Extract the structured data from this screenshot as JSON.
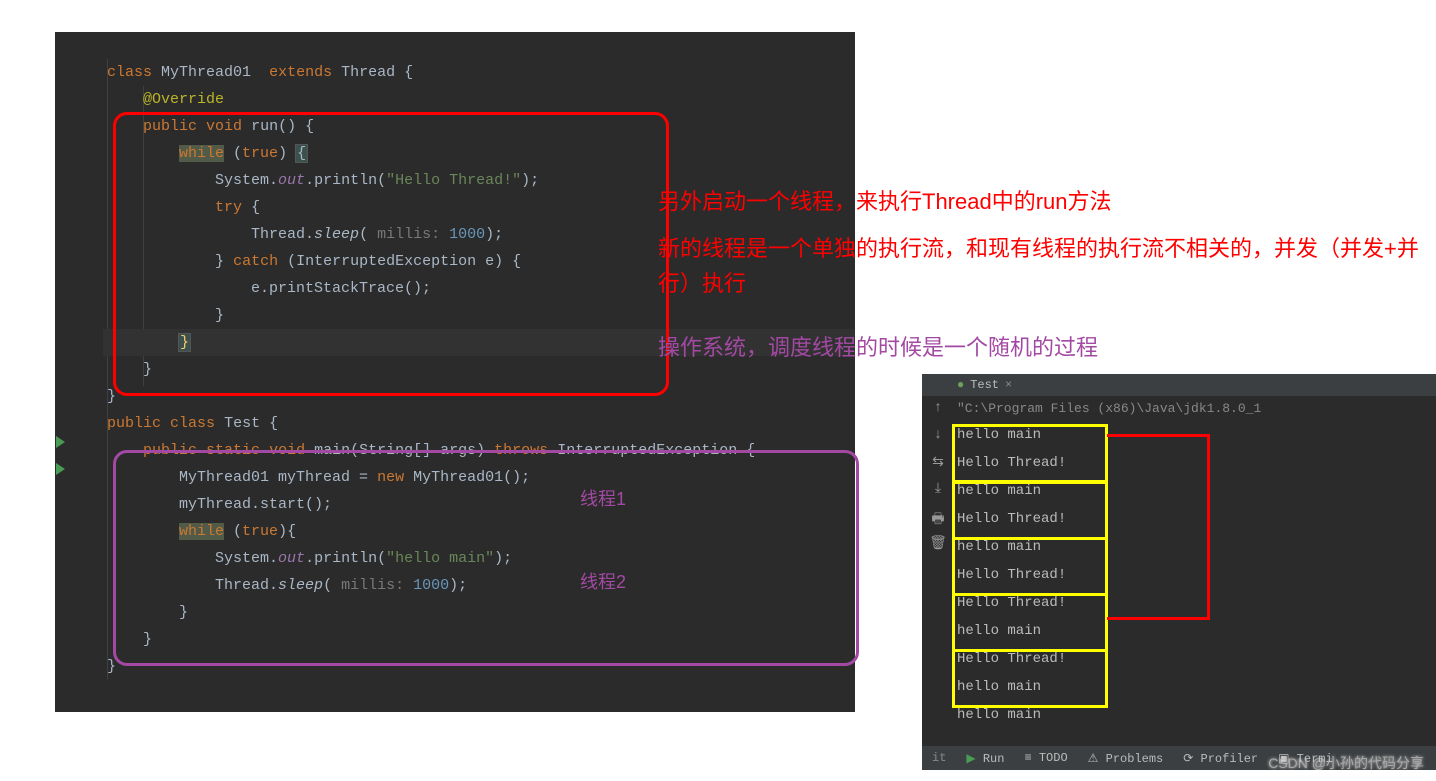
{
  "code": {
    "class_decl": {
      "kw1": "class",
      "name": "MyThread01",
      "kw2": "extends",
      "parent": "Thread",
      "brace": "{"
    },
    "override": "@Override",
    "run_decl": {
      "kw1": "public",
      "kw2": "void",
      "name": "run()",
      "brace": "{"
    },
    "while1": {
      "kw": "while",
      "cond": "true",
      "brace": "{"
    },
    "println1": {
      "obj": "System.",
      "field": "out",
      "call": ".println(",
      "str": "\"Hello Thread!\"",
      "end": ");"
    },
    "try": {
      "kw": "try",
      "brace": "{"
    },
    "sleep1": {
      "obj": "Thread.",
      "method": "sleep",
      "open": "(",
      "hint": " millis: ",
      "val": "1000",
      "end": ");"
    },
    "catch": {
      "close": "}",
      "kw": "catch",
      "open": "(",
      "type": "InterruptedException e",
      "end": ") {"
    },
    "stacktrace": "e.printStackTrace();",
    "close_catch": "}",
    "close_while1": "}",
    "close_run": "}",
    "close_class1": "}",
    "test_decl": {
      "kw1": "public",
      "kw2": "class",
      "name": "Test",
      "brace": "{"
    },
    "main_decl": {
      "kw1": "public",
      "kw2": "static",
      "kw3": "void",
      "name": "main",
      "args": "(String[] args)",
      "kw4": "throws",
      "exc": "InterruptedException",
      "brace": "{"
    },
    "new_thread": {
      "var": "MyThread01 myThread = ",
      "kw": "new",
      "ctor": " MyThread01();"
    },
    "start": "myThread.start();",
    "while2": {
      "kw": "while",
      "cond": "true",
      "brace": "{"
    },
    "println2": {
      "obj": "System.",
      "field": "out",
      "call": ".println(",
      "str": "\"hello main\"",
      "end": ");"
    },
    "sleep2": {
      "obj": "Thread.",
      "method": "sleep",
      "open": "(",
      "hint": " millis: ",
      "val": "1000",
      "end": ");"
    },
    "close_while2": "}",
    "close_main": "}",
    "close_class2": "}"
  },
  "annotations": {
    "red1": "另外启动一个线程，来执行Thread中的run方法",
    "red2": "新的线程是一个单独的执行流，和现有线程的执行流不相关的，并发（并发+并行）执行",
    "purple1": "操作系统，调度线程的时候是一个随机的过程",
    "th1": "线程1",
    "th2": "线程2"
  },
  "console": {
    "tab": "Test",
    "path": "\"C:\\Program Files (x86)\\Java\\jdk1.8.0_1",
    "lines": [
      "hello main",
      "Hello Thread!",
      "hello main",
      "Hello Thread!",
      "hello main",
      "Hello Thread!",
      "Hello Thread!",
      "hello main",
      "Hello Thread!",
      "hello main",
      "hello main"
    ]
  },
  "bottom": {
    "run": "Run",
    "todo": "TODO",
    "problems": "Problems",
    "profiler": "Profiler",
    "term": "Termi"
  },
  "watermark": "CSDN @小孙的代码分享"
}
